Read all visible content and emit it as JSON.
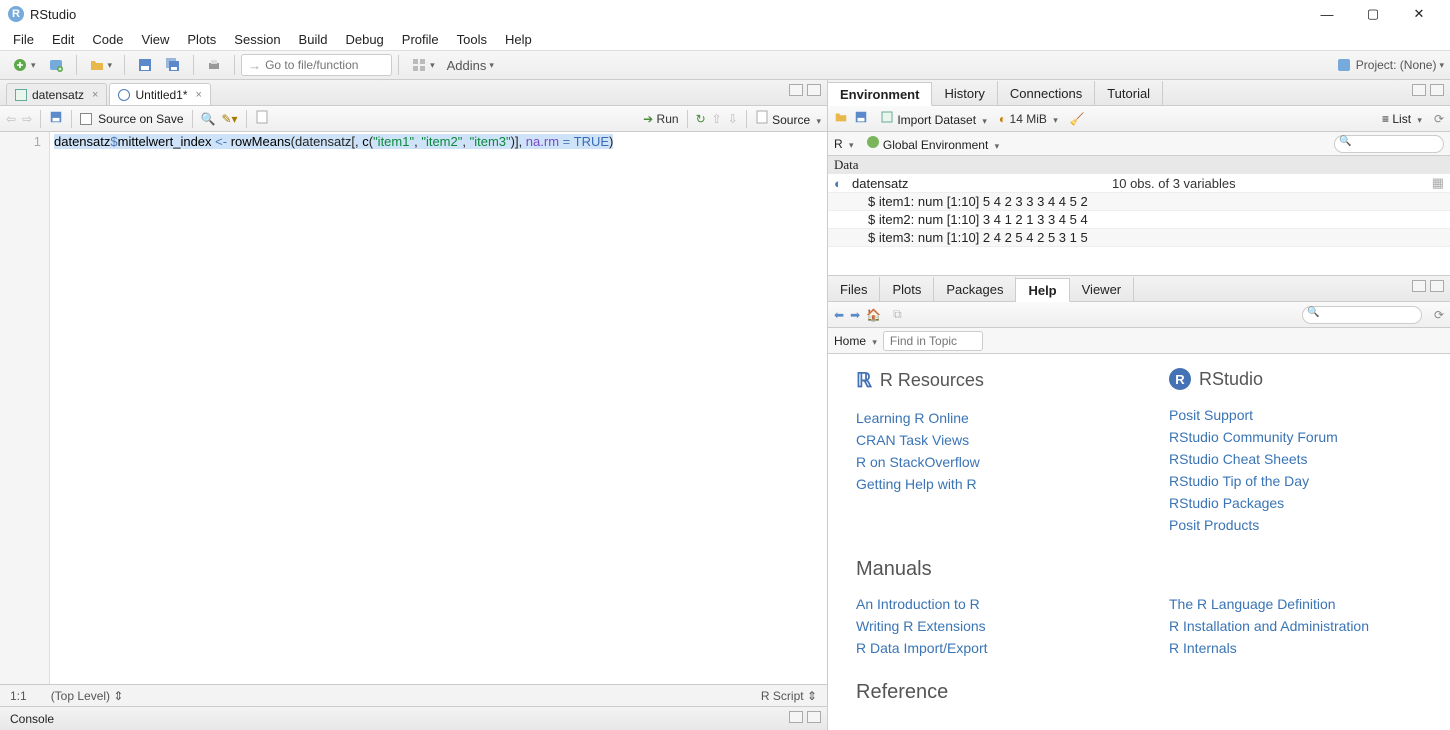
{
  "window": {
    "title": "RStudio"
  },
  "menus": [
    "File",
    "Edit",
    "Code",
    "View",
    "Plots",
    "Session",
    "Build",
    "Debug",
    "Profile",
    "Tools",
    "Help"
  ],
  "toolbar": {
    "goto_placeholder": "Go to file/function",
    "addins_label": "Addins",
    "project_label": "Project: (None)"
  },
  "source": {
    "tabs": [
      {
        "label": "datensatz",
        "type": "data"
      },
      {
        "label": "Untitled1*",
        "type": "rfile"
      }
    ],
    "source_on_save": "Source on Save",
    "run_label": "Run",
    "source_label": "Source",
    "line_number": "1",
    "code_tokens": {
      "var1": "datensatz",
      "dollar": "$",
      "var2": "mittelwert_index",
      "assign": " <- ",
      "fn": "rowMeans",
      "open": "(datensatz[, ",
      "cfn": "c",
      "paren": "(",
      "s1": "\"item1\"",
      "c1": ", ",
      "s2": "\"item2\"",
      "c2": ", ",
      "s3": "\"item3\"",
      "close1": ")], ",
      "narm": "na.rm",
      "eq": " = ",
      "true": "TRUE",
      "close2": ")"
    },
    "status": {
      "pos": "1:1",
      "scope": "(Top Level)",
      "lang": "R Script"
    }
  },
  "console_tab": "Console",
  "env": {
    "tabs": [
      "Environment",
      "History",
      "Connections",
      "Tutorial"
    ],
    "import_label": "Import Dataset",
    "mem_label": "14 MiB",
    "list_label": "List",
    "scope_r": "R",
    "scope_global": "Global Environment",
    "data_hdr": "Data",
    "obj": {
      "name": "datensatz",
      "summary": "10 obs. of 3 variables"
    },
    "items": [
      "$ item1: num [1:10] 5 4 2 3 3 3 4 4 5 2",
      "$ item2: num [1:10] 3 4 1 2 1 3 3 4 5 4",
      "$ item3: num [1:10] 2 4 2 5 4 2 5 3 1 5"
    ]
  },
  "help": {
    "tabs": [
      "Files",
      "Plots",
      "Packages",
      "Help",
      "Viewer"
    ],
    "home_label": "Home",
    "find_placeholder": "Find in Topic",
    "r_resources_hdr": "R Resources",
    "rstudio_hdr": "RStudio",
    "r_links": [
      "Learning R Online",
      "CRAN Task Views",
      "R on StackOverflow",
      "Getting Help with R"
    ],
    "rs_links": [
      "Posit Support",
      "RStudio Community Forum",
      "RStudio Cheat Sheets",
      "RStudio Tip of the Day",
      "RStudio Packages",
      "Posit Products"
    ],
    "manuals_hdr": "Manuals",
    "manual_l": [
      "An Introduction to R",
      "Writing R Extensions",
      "R Data Import/Export"
    ],
    "manual_r": [
      "The R Language Definition",
      "R Installation and Administration",
      "R Internals"
    ],
    "reference_hdr": "Reference"
  }
}
